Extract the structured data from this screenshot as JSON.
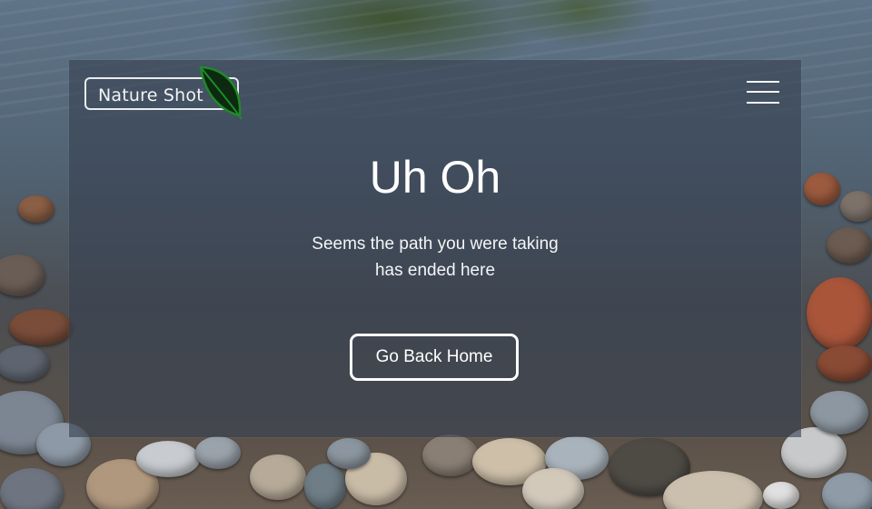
{
  "header": {
    "logo_text": "Nature Shot",
    "logo_icon": "leaf-icon",
    "menu_icon": "hamburger-menu-icon"
  },
  "main": {
    "heading": "Uh Oh",
    "message": "Seems the path you were taking has ended here",
    "home_button_label": "Go Back Home"
  },
  "colors": {
    "card_overlay": "#37414f",
    "text": "#ffffff",
    "leaf_outline": "#1f8a2a",
    "leaf_fill": "#0d2a10"
  }
}
